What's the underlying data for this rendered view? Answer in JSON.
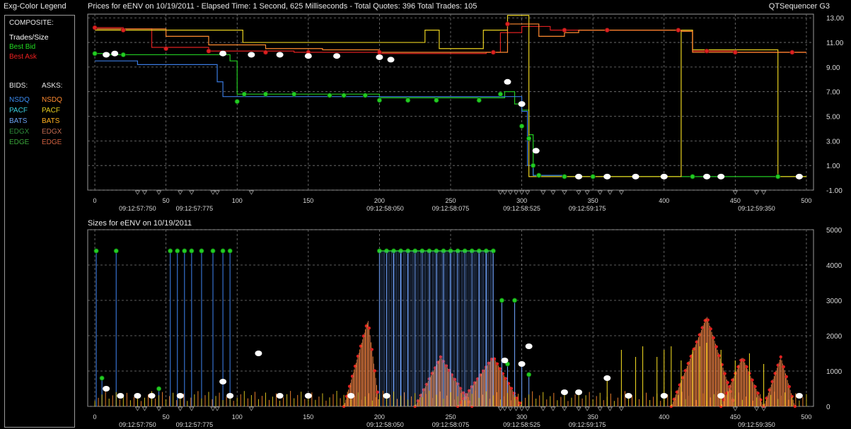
{
  "legend": {
    "title": "Exg-Color Legend",
    "composite_label": "COMPOSITE:",
    "trades_label": "Trades/Size",
    "best_bid_label": "Best Bid",
    "best_ask_label": "Best Ask",
    "bids_label": "BIDS:",
    "asks_label": "ASKS:",
    "bid_exchanges": [
      "NSDQ",
      "PACF",
      "BATS",
      "EDGX",
      "EDGE"
    ],
    "ask_exchanges": [
      "NSDQ",
      "PACF",
      "BATS",
      "EDGX",
      "EDGE"
    ]
  },
  "header": {
    "prices_title": "Prices for  eENV  on  10/19/2011   -  Elapsed Time: 1 Second, 625 Milliseconds   -  Total Quotes: 396  Total Trades: 105",
    "app_name": "QTSequencer G3",
    "sizes_title": "Sizes for  eENV  on  10/19/2011"
  },
  "colors": {
    "background": "#000000",
    "grid": "#7a7a7a",
    "trades": "#ffffff",
    "best_bid": "#22cc22",
    "best_ask": "#dd2020",
    "nsdq_bid": "#3a7ae0",
    "pacf_bid": "#3ad0e0",
    "bats_bid": "#6a9af0",
    "edgx_bid": "#2e8b3a",
    "edge_bid": "#3aa63a",
    "nsdq_ask": "#ff8a30",
    "pacf_ask": "#e8d020",
    "bats_ask": "#ffb020",
    "edgx_ask": "#c06a50",
    "edge_ask": "#d06040"
  },
  "chart_data": [
    {
      "type": "line",
      "name": "prices",
      "x_ticks": [
        0,
        50,
        100,
        150,
        200,
        250,
        300,
        350,
        400,
        450,
        500
      ],
      "xlim": [
        -5,
        505
      ],
      "y_ticks": [
        13.0,
        11.0,
        9.0,
        7.0,
        5.0,
        3.0,
        1.0,
        -1.0
      ],
      "y_tick_labels": [
        "13.00",
        "11.00",
        "9.00",
        "7.00",
        "5.00",
        "3.00",
        "1.00",
        "-1.00"
      ],
      "ylim": [
        -1,
        13.3
      ],
      "time_labels": [
        {
          "x": 30,
          "label": "09:12:57:750"
        },
        {
          "x": 70,
          "label": "09:12:57:775"
        },
        {
          "x": 204,
          "label": "09:12:58:050"
        },
        {
          "x": 250,
          "label": "09:12:58:075"
        },
        {
          "x": 300,
          "label": "09:12:58:525"
        },
        {
          "x": 346,
          "label": "09:12:59:175"
        },
        {
          "x": 465,
          "label": "09:12:59:350"
        }
      ],
      "series": [
        {
          "role": "best_ask",
          "points": [
            [
              0,
              12.2
            ],
            [
              20,
              12.1
            ],
            [
              40,
              10.6
            ],
            [
              80,
              10.3
            ],
            [
              140,
              10.2
            ],
            [
              200,
              10.1
            ],
            [
              250,
              10.1
            ],
            [
              275,
              10.2
            ],
            [
              285,
              11.8
            ],
            [
              300,
              12.3
            ],
            [
              320,
              12.0
            ],
            [
              350,
              12.0
            ],
            [
              400,
              12.0
            ],
            [
              412,
              12.0
            ],
            [
              420,
              10.3
            ],
            [
              450,
              10.2
            ],
            [
              500,
              10.2
            ]
          ]
        },
        {
          "role": "best_bid",
          "points": [
            [
              0,
              10.1
            ],
            [
              10,
              10.0
            ],
            [
              40,
              10.0
            ],
            [
              80,
              10.0
            ],
            [
              95,
              9.5
            ],
            [
              100,
              6.8
            ],
            [
              140,
              6.8
            ],
            [
              200,
              6.5
            ],
            [
              280,
              6.5
            ],
            [
              288,
              7.0
            ],
            [
              295,
              6.0
            ],
            [
              300,
              5.5
            ],
            [
              305,
              3.5
            ],
            [
              308,
              0.2
            ],
            [
              330,
              0.1
            ],
            [
              400,
              0.1
            ],
            [
              480,
              0.1
            ],
            [
              500,
              0.1
            ]
          ]
        },
        {
          "role": "nsdq_bid",
          "points": [
            [
              0,
              9.5
            ],
            [
              20,
              9.5
            ],
            [
              30,
              9.2
            ],
            [
              80,
              9.2
            ],
            [
              86,
              9.2
            ],
            [
              86,
              7.8
            ],
            [
              90,
              7.8
            ],
            [
              90,
              6.6
            ],
            [
              140,
              6.6
            ],
            [
              200,
              6.6
            ],
            [
              285,
              6.6
            ],
            [
              300,
              5.4
            ],
            [
              304,
              1.0
            ],
            [
              308,
              0.2
            ],
            [
              330,
              0.1
            ]
          ]
        },
        {
          "role": "pacf_ask",
          "points": [
            [
              0,
              12.0
            ],
            [
              100,
              12.0
            ],
            [
              104,
              11.0
            ],
            [
              150,
              11.0
            ],
            [
              190,
              11.0
            ],
            [
              230,
              11.0
            ],
            [
              232,
              12.0
            ],
            [
              240,
              12.0
            ],
            [
              242,
              10.5
            ],
            [
              270,
              10.5
            ],
            [
              273,
              12.0
            ],
            [
              285,
              12.0
            ],
            [
              290,
              13.2
            ],
            [
              305,
              13.2
            ],
            [
              305,
              0.1
            ],
            [
              380,
              0.1
            ],
            [
              410,
              0.1
            ],
            [
              412,
              12.0
            ],
            [
              420,
              12.0
            ],
            [
              420,
              10.4
            ],
            [
              480,
              10.4
            ],
            [
              480,
              0.1
            ],
            [
              500,
              0.1
            ]
          ]
        },
        {
          "role": "nsdq_ask",
          "points": [
            [
              0,
              12.1
            ],
            [
              50,
              11.5
            ],
            [
              80,
              10.8
            ],
            [
              120,
              10.5
            ],
            [
              160,
              10.4
            ],
            [
              200,
              10.2
            ],
            [
              280,
              10.2
            ],
            [
              290,
              12.5
            ],
            [
              310,
              12.5
            ],
            [
              312,
              11.5
            ],
            [
              330,
              11.8
            ],
            [
              340,
              12.0
            ],
            [
              400,
              12.0
            ],
            [
              412,
              11.9
            ],
            [
              420,
              10.2
            ],
            [
              500,
              10.2
            ]
          ]
        }
      ],
      "trades": [
        [
          8,
          10.0
        ],
        [
          14,
          10.1
        ],
        [
          90,
          10.1
        ],
        [
          110,
          10.0
        ],
        [
          130,
          10.0
        ],
        [
          150,
          9.9
        ],
        [
          170,
          9.9
        ],
        [
          200,
          9.8
        ],
        [
          208,
          9.6
        ],
        [
          290,
          7.8
        ],
        [
          300,
          6.0
        ],
        [
          310,
          2.2
        ],
        [
          340,
          0.1
        ],
        [
          360,
          0.1
        ],
        [
          380,
          0.1
        ],
        [
          400,
          0.1
        ],
        [
          430,
          0.1
        ],
        [
          440,
          0.1
        ],
        [
          495,
          0.1
        ]
      ],
      "bid_markers": [
        [
          0,
          10.1
        ],
        [
          20,
          10.0
        ],
        [
          100,
          6.2
        ],
        [
          105,
          6.8
        ],
        [
          120,
          6.8
        ],
        [
          140,
          6.8
        ],
        [
          165,
          6.7
        ],
        [
          175,
          6.7
        ],
        [
          190,
          6.7
        ],
        [
          200,
          6.3
        ],
        [
          220,
          6.3
        ],
        [
          240,
          6.3
        ],
        [
          270,
          6.3
        ],
        [
          285,
          6.8
        ],
        [
          300,
          4.2
        ],
        [
          305,
          3.2
        ],
        [
          308,
          1.0
        ],
        [
          312,
          0.2
        ],
        [
          330,
          0.1
        ],
        [
          350,
          0.1
        ],
        [
          380,
          0.1
        ],
        [
          420,
          0.1
        ],
        [
          480,
          0.1
        ]
      ],
      "ask_markers": [
        [
          0,
          12.2
        ],
        [
          20,
          12.0
        ],
        [
          50,
          10.5
        ],
        [
          80,
          10.3
        ],
        [
          120,
          10.2
        ],
        [
          150,
          10.2
        ],
        [
          200,
          10.2
        ],
        [
          280,
          10.2
        ],
        [
          290,
          12.5
        ],
        [
          330,
          12.0
        ],
        [
          360,
          12.0
        ],
        [
          410,
          12.0
        ],
        [
          430,
          10.3
        ],
        [
          450,
          10.2
        ],
        [
          490,
          10.2
        ]
      ]
    },
    {
      "type": "bar",
      "name": "sizes",
      "x_ticks": [
        0,
        50,
        100,
        150,
        200,
        250,
        300,
        350,
        400,
        450,
        500
      ],
      "xlim": [
        -5,
        505
      ],
      "y_ticks": [
        0,
        1000,
        2000,
        3000,
        4000,
        5000
      ],
      "y_tick_labels": [
        "0",
        "1000",
        "2000",
        "3000",
        "4000",
        "5000"
      ],
      "ylim": [
        0,
        5000
      ],
      "series": [
        {
          "role": "nsdq_bid",
          "points": [
            [
              1,
              4400
            ],
            [
              5,
              800
            ],
            [
              15,
              4400
            ],
            [
              45,
              500
            ],
            [
              53,
              4400
            ],
            [
              58,
              4400
            ],
            [
              63,
              4400
            ],
            [
              68,
              4400
            ],
            [
              75,
              4400
            ],
            [
              83,
              4400
            ],
            [
              90,
              4400
            ],
            [
              95,
              4400
            ]
          ]
        },
        {
          "role": "bats_bid",
          "points": [
            [
              200,
              4400
            ],
            [
              205,
              4400
            ],
            [
              210,
              4400
            ],
            [
              215,
              4400
            ],
            [
              220,
              4400
            ],
            [
              225,
              4400
            ],
            [
              230,
              4400
            ],
            [
              235,
              4400
            ],
            [
              240,
              4400
            ],
            [
              245,
              4400
            ],
            [
              250,
              4400
            ],
            [
              255,
              4400
            ],
            [
              260,
              4400
            ],
            [
              265,
              4400
            ],
            [
              270,
              4400
            ],
            [
              275,
              4400
            ],
            [
              280,
              4400
            ],
            [
              286,
              3000
            ],
            [
              290,
              1200
            ],
            [
              295,
              3000
            ],
            [
              300,
              1200
            ],
            [
              305,
              900
            ]
          ]
        },
        {
          "role": "pacf_ask",
          "points": [
            [
              360,
              800
            ],
            [
              370,
              1600
            ],
            [
              380,
              1400
            ],
            [
              385,
              1700
            ],
            [
              395,
              1400
            ],
            [
              400,
              1600
            ],
            [
              405,
              1700
            ],
            [
              412,
              1300
            ],
            [
              420,
              1600
            ],
            [
              425,
              1700
            ],
            [
              430,
              1800
            ],
            [
              440,
              1600
            ],
            [
              450,
              1300
            ],
            [
              460,
              1500
            ],
            [
              470,
              1200
            ]
          ]
        },
        {
          "role": "best_bid_line",
          "points": [
            [
              200,
              4400
            ],
            [
              280,
              4400
            ]
          ]
        }
      ],
      "ask_ramps": [
        {
          "start": 175,
          "peak_x": 192,
          "peak_y": 2450,
          "end": 200
        },
        {
          "start": 225,
          "peak_x": 243,
          "peak_y": 1400,
          "end": 265
        },
        {
          "start": 255,
          "peak_x": 280,
          "peak_y": 1400,
          "end": 300
        },
        {
          "start": 405,
          "peak_x": 430,
          "peak_y": 2550,
          "end": 450
        },
        {
          "start": 440,
          "peak_x": 455,
          "peak_y": 1400,
          "end": 470
        },
        {
          "start": 470,
          "peak_x": 482,
          "peak_y": 1400,
          "end": 492
        }
      ],
      "trades": [
        [
          8,
          500
        ],
        [
          18,
          300
        ],
        [
          30,
          300
        ],
        [
          40,
          300
        ],
        [
          60,
          300
        ],
        [
          90,
          700
        ],
        [
          95,
          300
        ],
        [
          115,
          1500
        ],
        [
          130,
          300
        ],
        [
          150,
          300
        ],
        [
          180,
          300
        ],
        [
          205,
          300
        ],
        [
          288,
          1300
        ],
        [
          300,
          1200
        ],
        [
          305,
          1700
        ],
        [
          330,
          400
        ],
        [
          340,
          400
        ],
        [
          360,
          800
        ],
        [
          375,
          300
        ],
        [
          400,
          300
        ],
        [
          440,
          300
        ],
        [
          495,
          300
        ]
      ]
    }
  ]
}
